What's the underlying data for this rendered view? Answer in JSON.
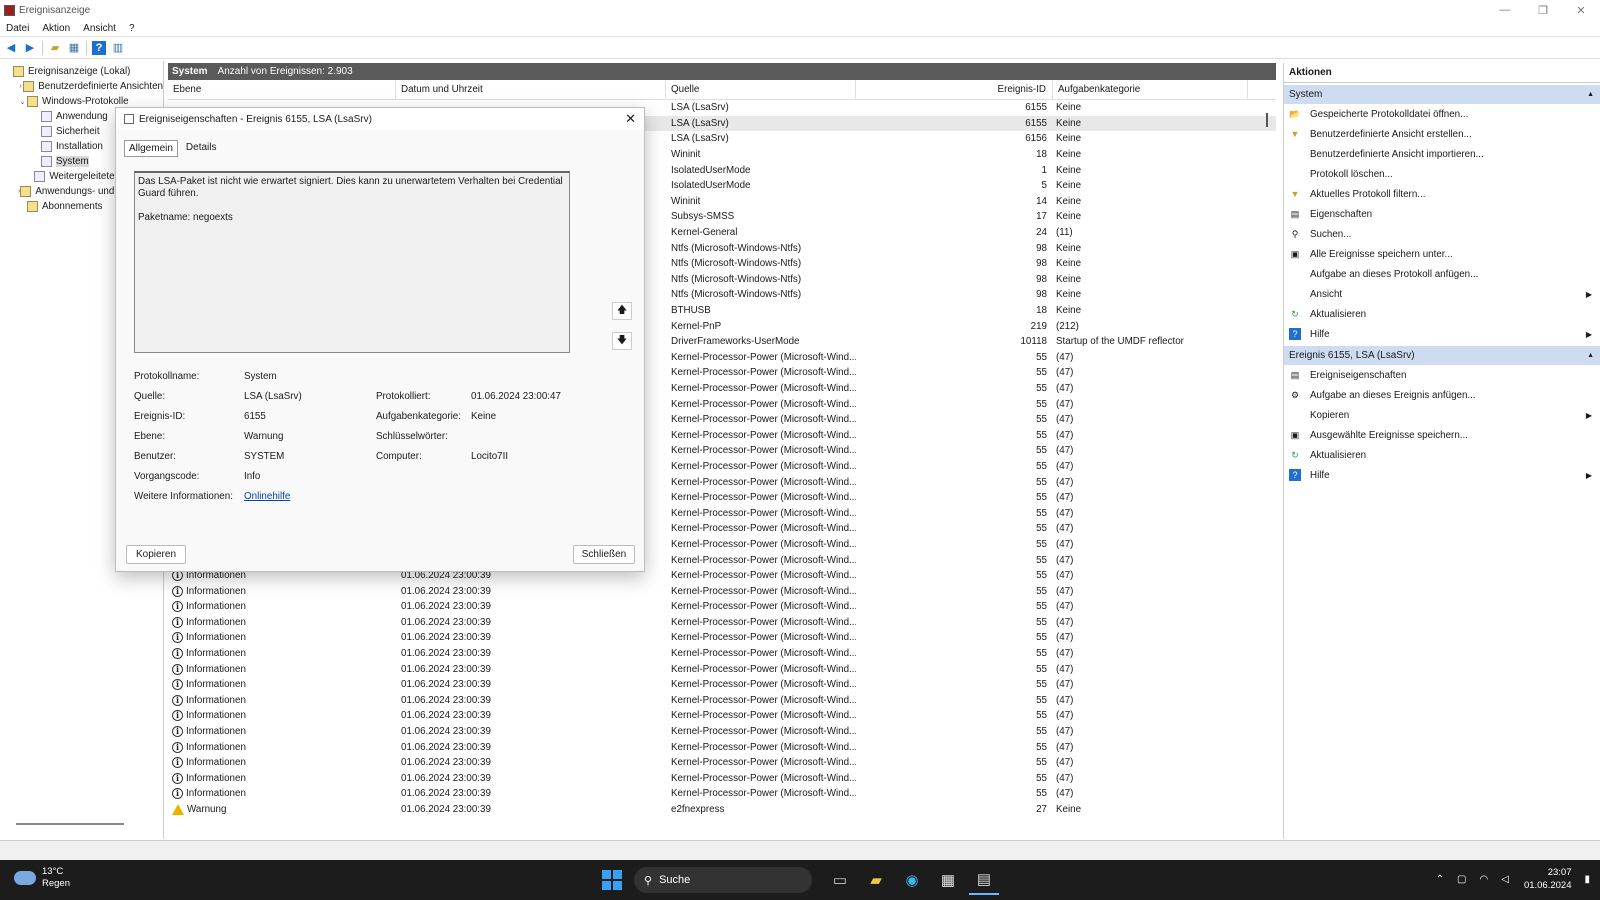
{
  "window": {
    "title": "Ereignisanzeige"
  },
  "menu": [
    "Datei",
    "Aktion",
    "Ansicht",
    "?"
  ],
  "tree": [
    {
      "label": "Ereignisanzeige (Lokal)",
      "level": 0,
      "arrow": "",
      "icon": "computer-icon"
    },
    {
      "label": "Benutzerdefinierte Ansichten",
      "level": 1,
      "arrow": "›",
      "icon": "folder-icon"
    },
    {
      "label": "Windows-Protokolle",
      "level": 1,
      "arrow": "⌄",
      "icon": "folder-icon"
    },
    {
      "label": "Anwendung",
      "level": 2,
      "arrow": "",
      "icon": "log-icon"
    },
    {
      "label": "Sicherheit",
      "level": 2,
      "arrow": "",
      "icon": "log-icon"
    },
    {
      "label": "Installation",
      "level": 2,
      "arrow": "",
      "icon": "log-icon"
    },
    {
      "label": "System",
      "level": 2,
      "arrow": "",
      "icon": "log-icon",
      "selected": true
    },
    {
      "label": "Weitergeleitete Ereignisse",
      "level": 2,
      "arrow": "",
      "icon": "log-icon"
    },
    {
      "label": "Anwendungs- und Dienstprotokolle",
      "level": 1,
      "arrow": "›",
      "icon": "folder-icon"
    },
    {
      "label": "Abonnements",
      "level": 1,
      "arrow": "",
      "icon": "folder-icon"
    }
  ],
  "center": {
    "header_title": "System",
    "header_count": "Anzahl von Ereignissen: 2.903",
    "columns": [
      "Ebene",
      "Datum und Uhrzeit",
      "Quelle",
      "Ereignis-ID",
      "Aufgabenkategorie"
    ],
    "rows": [
      {
        "level": "",
        "date": "",
        "source": "LSA (LsaSrv)",
        "id": "6155",
        "cat": "Keine"
      },
      {
        "level": "",
        "date": "",
        "source": "LSA (LsaSrv)",
        "id": "6155",
        "cat": "Keine",
        "hl": true
      },
      {
        "level": "",
        "date": "",
        "source": "LSA (LsaSrv)",
        "id": "6156",
        "cat": "Keine"
      },
      {
        "level": "",
        "date": "",
        "source": "Wininit",
        "id": "18",
        "cat": "Keine"
      },
      {
        "level": "",
        "date": "",
        "source": "IsolatedUserMode",
        "id": "1",
        "cat": "Keine"
      },
      {
        "level": "",
        "date": "",
        "source": "IsolatedUserMode",
        "id": "5",
        "cat": "Keine"
      },
      {
        "level": "",
        "date": "",
        "source": "Wininit",
        "id": "14",
        "cat": "Keine"
      },
      {
        "level": "",
        "date": "",
        "source": "Subsys-SMSS",
        "id": "17",
        "cat": "Keine"
      },
      {
        "level": "",
        "date": "",
        "source": "Kernel-General",
        "id": "24",
        "cat": "(11)"
      },
      {
        "level": "",
        "date": "",
        "source": "Ntfs (Microsoft-Windows-Ntfs)",
        "id": "98",
        "cat": "Keine"
      },
      {
        "level": "",
        "date": "",
        "source": "Ntfs (Microsoft-Windows-Ntfs)",
        "id": "98",
        "cat": "Keine"
      },
      {
        "level": "",
        "date": "",
        "source": "Ntfs (Microsoft-Windows-Ntfs)",
        "id": "98",
        "cat": "Keine"
      },
      {
        "level": "",
        "date": "",
        "source": "Ntfs (Microsoft-Windows-Ntfs)",
        "id": "98",
        "cat": "Keine"
      },
      {
        "level": "",
        "date": "",
        "source": "BTHUSB",
        "id": "18",
        "cat": "Keine"
      },
      {
        "level": "",
        "date": "",
        "source": "Kernel-PnP",
        "id": "219",
        "cat": "(212)"
      },
      {
        "level": "",
        "date": "",
        "source": "DriverFrameworks-UserMode",
        "id": "10118",
        "cat": "Startup of the UMDF reflector"
      },
      {
        "level": "",
        "date": "",
        "source": "Kernel-Processor-Power (Microsoft-Wind...",
        "id": "55",
        "cat": "(47)"
      },
      {
        "level": "",
        "date": "",
        "source": "Kernel-Processor-Power (Microsoft-Wind...",
        "id": "55",
        "cat": "(47)"
      },
      {
        "level": "",
        "date": "",
        "source": "Kernel-Processor-Power (Microsoft-Wind...",
        "id": "55",
        "cat": "(47)"
      },
      {
        "level": "",
        "date": "",
        "source": "Kernel-Processor-Power (Microsoft-Wind...",
        "id": "55",
        "cat": "(47)"
      },
      {
        "level": "",
        "date": "",
        "source": "Kernel-Processor-Power (Microsoft-Wind...",
        "id": "55",
        "cat": "(47)"
      },
      {
        "level": "",
        "date": "",
        "source": "Kernel-Processor-Power (Microsoft-Wind...",
        "id": "55",
        "cat": "(47)"
      },
      {
        "level": "",
        "date": "",
        "source": "Kernel-Processor-Power (Microsoft-Wind...",
        "id": "55",
        "cat": "(47)"
      },
      {
        "level": "",
        "date": "",
        "source": "Kernel-Processor-Power (Microsoft-Wind...",
        "id": "55",
        "cat": "(47)"
      },
      {
        "level": "",
        "date": "",
        "source": "Kernel-Processor-Power (Microsoft-Wind...",
        "id": "55",
        "cat": "(47)"
      },
      {
        "level": "",
        "date": "",
        "source": "Kernel-Processor-Power (Microsoft-Wind...",
        "id": "55",
        "cat": "(47)"
      },
      {
        "level": "",
        "date": "",
        "source": "Kernel-Processor-Power (Microsoft-Wind...",
        "id": "55",
        "cat": "(47)"
      },
      {
        "level": "",
        "date": "",
        "source": "Kernel-Processor-Power (Microsoft-Wind...",
        "id": "55",
        "cat": "(47)"
      },
      {
        "level": "",
        "date": "",
        "source": "Kernel-Processor-Power (Microsoft-Wind...",
        "id": "55",
        "cat": "(47)"
      },
      {
        "level": "Informationen",
        "date": "01.06.2024 23:00:39",
        "source": "Kernel-Processor-Power (Microsoft-Wind...",
        "id": "55",
        "cat": "(47)",
        "icon": "info"
      },
      {
        "level": "Informationen",
        "date": "01.06.2024 23:00:39",
        "source": "Kernel-Processor-Power (Microsoft-Wind...",
        "id": "55",
        "cat": "(47)",
        "icon": "info"
      },
      {
        "level": "Informationen",
        "date": "01.06.2024 23:00:39",
        "source": "Kernel-Processor-Power (Microsoft-Wind...",
        "id": "55",
        "cat": "(47)",
        "icon": "info"
      },
      {
        "level": "Informationen",
        "date": "01.06.2024 23:00:39",
        "source": "Kernel-Processor-Power (Microsoft-Wind...",
        "id": "55",
        "cat": "(47)",
        "icon": "info"
      },
      {
        "level": "Informationen",
        "date": "01.06.2024 23:00:39",
        "source": "Kernel-Processor-Power (Microsoft-Wind...",
        "id": "55",
        "cat": "(47)",
        "icon": "info"
      },
      {
        "level": "Informationen",
        "date": "01.06.2024 23:00:39",
        "source": "Kernel-Processor-Power (Microsoft-Wind...",
        "id": "55",
        "cat": "(47)",
        "icon": "info"
      },
      {
        "level": "Informationen",
        "date": "01.06.2024 23:00:39",
        "source": "Kernel-Processor-Power (Microsoft-Wind...",
        "id": "55",
        "cat": "(47)",
        "icon": "info"
      },
      {
        "level": "Informationen",
        "date": "01.06.2024 23:00:39",
        "source": "Kernel-Processor-Power (Microsoft-Wind...",
        "id": "55",
        "cat": "(47)",
        "icon": "info"
      },
      {
        "level": "Informationen",
        "date": "01.06.2024 23:00:39",
        "source": "Kernel-Processor-Power (Microsoft-Wind...",
        "id": "55",
        "cat": "(47)",
        "icon": "info"
      },
      {
        "level": "Informationen",
        "date": "01.06.2024 23:00:39",
        "source": "Kernel-Processor-Power (Microsoft-Wind...",
        "id": "55",
        "cat": "(47)",
        "icon": "info"
      },
      {
        "level": "Informationen",
        "date": "01.06.2024 23:00:39",
        "source": "Kernel-Processor-Power (Microsoft-Wind...",
        "id": "55",
        "cat": "(47)",
        "icon": "info"
      },
      {
        "level": "Informationen",
        "date": "01.06.2024 23:00:39",
        "source": "Kernel-Processor-Power (Microsoft-Wind...",
        "id": "55",
        "cat": "(47)",
        "icon": "info"
      },
      {
        "level": "Informationen",
        "date": "01.06.2024 23:00:39",
        "source": "Kernel-Processor-Power (Microsoft-Wind...",
        "id": "55",
        "cat": "(47)",
        "icon": "info"
      },
      {
        "level": "Informationen",
        "date": "01.06.2024 23:00:39",
        "source": "Kernel-Processor-Power (Microsoft-Wind...",
        "id": "55",
        "cat": "(47)",
        "icon": "info"
      },
      {
        "level": "Informationen",
        "date": "01.06.2024 23:00:39",
        "source": "Kernel-Processor-Power (Microsoft-Wind...",
        "id": "55",
        "cat": "(47)",
        "icon": "info"
      },
      {
        "level": "Informationen",
        "date": "01.06.2024 23:00:39",
        "source": "Kernel-Processor-Power (Microsoft-Wind...",
        "id": "55",
        "cat": "(47)",
        "icon": "info"
      },
      {
        "level": "Warnung",
        "date": "01.06.2024 23:00:39",
        "source": "e2fnexpress",
        "id": "27",
        "cat": "Keine",
        "icon": "warn"
      }
    ]
  },
  "actions": {
    "header": "Aktionen",
    "sections": [
      {
        "title": "System",
        "items": [
          {
            "label": "Gespeicherte Protokolldatei öffnen...",
            "icon": "folder-open-icon",
            "glyph": "📂"
          },
          {
            "label": "Benutzerdefinierte Ansicht erstellen...",
            "icon": "filter-icon",
            "glyph": "▼"
          },
          {
            "label": "Benutzerdefinierte Ansicht importieren...",
            "icon": "",
            "glyph": ""
          },
          {
            "label": "Protokoll löschen...",
            "icon": "",
            "glyph": ""
          },
          {
            "label": "Aktuelles Protokoll filtern...",
            "icon": "filter-icon",
            "glyph": "▼"
          },
          {
            "label": "Eigenschaften",
            "icon": "properties-icon",
            "glyph": "▤"
          },
          {
            "label": "Suchen...",
            "icon": "binoculars-icon",
            "glyph": "⚲"
          },
          {
            "label": "Alle Ereignisse speichern unter...",
            "icon": "save-icon",
            "glyph": "▣"
          },
          {
            "label": "Aufgabe an dieses Protokoll anfügen...",
            "icon": "",
            "glyph": ""
          },
          {
            "label": "Ansicht",
            "icon": "",
            "glyph": "",
            "sub": true
          },
          {
            "label": "Aktualisieren",
            "icon": "refresh-icon",
            "glyph": "↻"
          },
          {
            "label": "Hilfe",
            "icon": "help-icon",
            "glyph": "?",
            "sub": true
          }
        ]
      },
      {
        "title": "Ereignis 6155, LSA (LsaSrv)",
        "items": [
          {
            "label": "Ereigniseigenschaften",
            "icon": "properties-icon",
            "glyph": "▤"
          },
          {
            "label": "Aufgabe an dieses Ereignis anfügen...",
            "icon": "task-icon",
            "glyph": "⚙"
          },
          {
            "label": "Kopieren",
            "icon": "",
            "glyph": "",
            "sub": true
          },
          {
            "label": "Ausgewählte Ereignisse speichern...",
            "icon": "save-icon",
            "glyph": "▣"
          },
          {
            "label": "Aktualisieren",
            "icon": "refresh-icon",
            "glyph": "↻"
          },
          {
            "label": "Hilfe",
            "icon": "help-icon",
            "glyph": "?",
            "sub": true
          }
        ]
      }
    ]
  },
  "dialog": {
    "title": "Ereigniseigenschaften - Ereignis 6155, LSA (LsaSrv)",
    "tabs": [
      "Allgemein",
      "Details"
    ],
    "message_line1": "Das LSA-Paket ist nicht wie erwartet signiert. Dies kann zu unerwartetem Verhalten bei Credential Guard führen.",
    "message_line2": "Paketname: negoexts",
    "fields": {
      "protokollname_label": "Protokollname:",
      "protokollname": "System",
      "quelle_label": "Quelle:",
      "quelle": "LSA (LsaSrv)",
      "protokolliert_label": "Protokolliert:",
      "protokolliert": "01.06.2024 23:00:47",
      "ereignisid_label": "Ereignis-ID:",
      "ereignisid": "6155",
      "aufgabenkategorie_label": "Aufgabenkategorie:",
      "aufgabenkategorie": "Keine",
      "ebene_label": "Ebene:",
      "ebene": "Warnung",
      "schluesselwoerter_label": "Schlüsselwörter:",
      "schluesselwoerter": "",
      "benutzer_label": "Benutzer:",
      "benutzer": "SYSTEM",
      "computer_label": "Computer:",
      "computer": "Locito7II",
      "vorgangscode_label": "Vorgangscode:",
      "vorgangscode": "Info",
      "weitere_label": "Weitere Informationen:",
      "weitere_link": "Onlinehilfe"
    },
    "copy_button": "Kopieren",
    "close_button": "Schließen"
  },
  "taskbar": {
    "temp": "13°C",
    "weather": "Regen",
    "search_placeholder": "Suche",
    "time": "23:07",
    "date": "01.06.2024"
  }
}
